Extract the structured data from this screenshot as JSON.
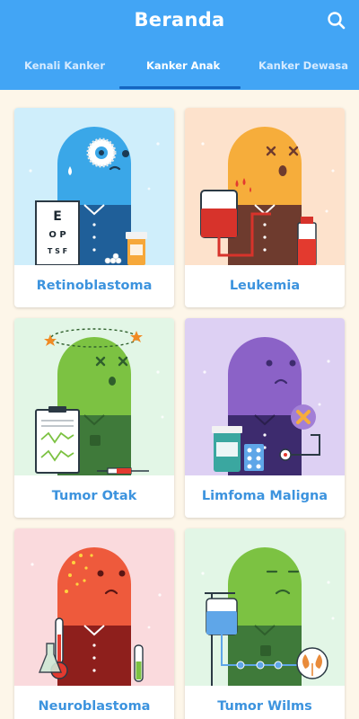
{
  "header": {
    "title": "Beranda",
    "search_icon": "search-icon",
    "bg_color": "#42a5f5"
  },
  "tabs": [
    {
      "label": "Kenali Kanker",
      "active": false
    },
    {
      "label": "Kanker Anak",
      "active": true
    },
    {
      "label": "Kanker Dewasa",
      "active": false
    }
  ],
  "cards": [
    {
      "label": "Retinoblastoma",
      "bg": "#cfeefb",
      "body": "#3aa7e8"
    },
    {
      "label": "Leukemia",
      "bg": "#fde2cc",
      "body": "#f6ad3b"
    },
    {
      "label": "Tumor Otak",
      "bg": "#e2f6e6",
      "body": "#7cc242"
    },
    {
      "label": "Limfoma Maligna",
      "bg": "#ddd0f3",
      "body": "#8b62c7"
    },
    {
      "label": "Neuroblastoma",
      "bg": "#fadadd",
      "body": "#ee5a3c"
    },
    {
      "label": "Tumor Wilms",
      "bg": "#e2f6e6",
      "body": "#7cc242"
    }
  ],
  "illustrations": {
    "eye_chart": [
      "E",
      "O P",
      "T S F"
    ]
  }
}
